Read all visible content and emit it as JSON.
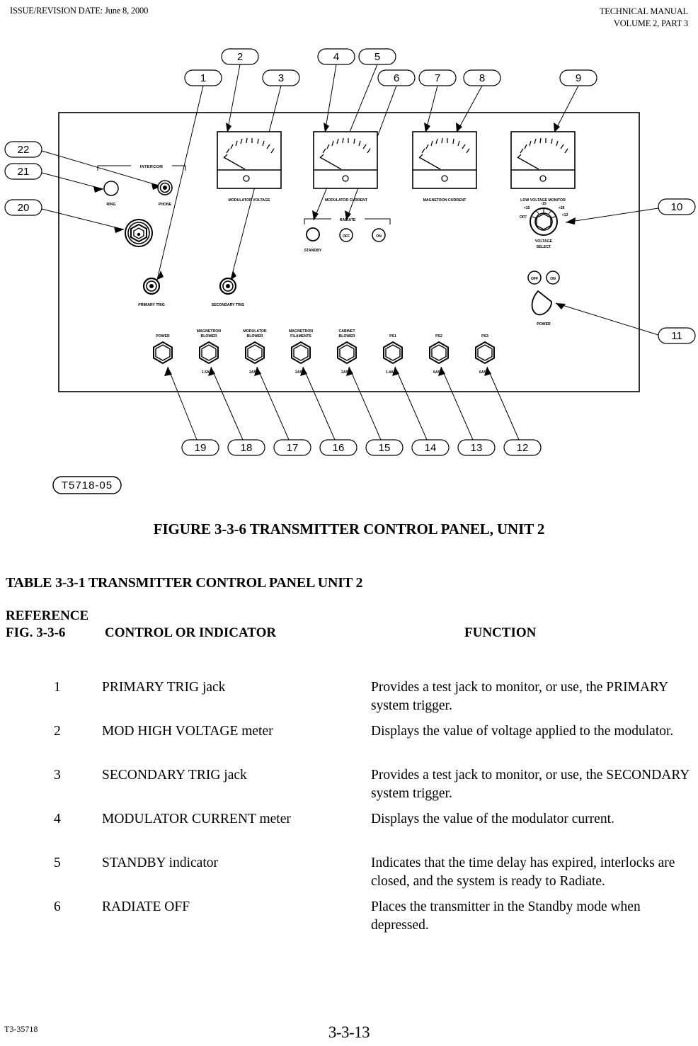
{
  "header": {
    "left": "ISSUE/REVISION DATE: June 8, 2000",
    "right_line1": "TECHNICAL MANUAL",
    "right_line2": "VOLUME 2, PART 3"
  },
  "figure": {
    "caption": "FIGURE 3-3-6  TRANSMITTER CONTROL PANEL,  UNIT 2",
    "drawing_number": "T5718-05",
    "callouts_top": [
      "1",
      "2",
      "3",
      "4",
      "5",
      "6",
      "7",
      "8",
      "9"
    ],
    "callouts_left": [
      "22",
      "21",
      "20"
    ],
    "callouts_right": [
      "10",
      "11"
    ],
    "callouts_bottom": [
      "19",
      "18",
      "17",
      "16",
      "15",
      "14",
      "13",
      "12"
    ],
    "meters": [
      {
        "label": "MODULATOR  VOLTAGE"
      },
      {
        "label": "MODULATOR  CURRENT"
      },
      {
        "label": "MAGNETRON  CURRENT"
      },
      {
        "label": "LOW  VOLTAGE  MONITOR"
      }
    ],
    "intercom": {
      "group_label": "INTERCOM",
      "ring_label": "RING",
      "phone_label": "PHONE"
    },
    "trig_jacks": [
      {
        "label": "PRIMARY  TRIG"
      },
      {
        "label": "SECONDARY  TRIG"
      }
    ],
    "radiate": {
      "group_label": "RADIATE",
      "standby_label": "STANDBY",
      "off_label": "OFF",
      "on_label": "ON"
    },
    "voltage_select": {
      "label_line1": "VOLTAGE",
      "label_line2": "SELECT",
      "positions": [
        "OFF",
        "+15",
        "-15",
        "+28",
        "+13"
      ]
    },
    "power_group": {
      "label": "POWER",
      "off_label": "OFF",
      "on_label": "ON"
    },
    "breakers": [
      {
        "label_line1": "POWER",
        "label_line2": "",
        "rating": ""
      },
      {
        "label_line1": "MAGNETRON",
        "label_line2": "BLOWER",
        "rating": "1.6AS"
      },
      {
        "label_line1": "MODULATOR",
        "label_line2": "BLOWER",
        "rating": "2AS"
      },
      {
        "label_line1": "MAGNETRON",
        "label_line2": "FILAMENTS",
        "rating": "2AS"
      },
      {
        "label_line1": "CABINET",
        "label_line2": "BLOWER",
        "rating": "2AS"
      },
      {
        "label_line1": "PS1",
        "label_line2": "",
        "rating": "1.4AS"
      },
      {
        "label_line1": "PS2",
        "label_line2": "",
        "rating": "6AS"
      },
      {
        "label_line1": "PS3",
        "label_line2": "",
        "rating": "6AS"
      }
    ]
  },
  "table": {
    "title": "TABLE 3-3-1  TRANSMITTER CONTROL PANEL UNIT 2",
    "head_reference": "REFERENCE",
    "head_fig": "FIG.  3-3-6",
    "head_control": "CONTROL OR INDICATOR",
    "head_function": "FUNCTION",
    "rows": [
      {
        "num": "1",
        "control": "PRIMARY TRIG jack",
        "function": "Provides a test jack to monitor, or use, the PRIMARY system trigger."
      },
      {
        "num": "2",
        "control": "MOD HIGH VOLTAGE meter",
        "function": "Displays the value of voltage applied to the modulator."
      },
      {
        "num": "3",
        "control": "SECONDARY TRIG jack",
        "function": "Provides a test jack to monitor, or use, the SECONDARY system trigger."
      },
      {
        "num": "4",
        "control": "MODULATOR CURRENT meter",
        "function": "Displays the value of the modulator current."
      },
      {
        "num": "5",
        "control": "STANDBY indicator",
        "function": "Indicates that the time delay has expired, interlocks are closed, and the system is ready to Radiate."
      },
      {
        "num": "6",
        "control": "RADIATE OFF",
        "function": "Places the transmitter in the Standby mode when depressed."
      }
    ]
  },
  "footer": {
    "left": "T3-35718",
    "page": "3-3-13"
  }
}
